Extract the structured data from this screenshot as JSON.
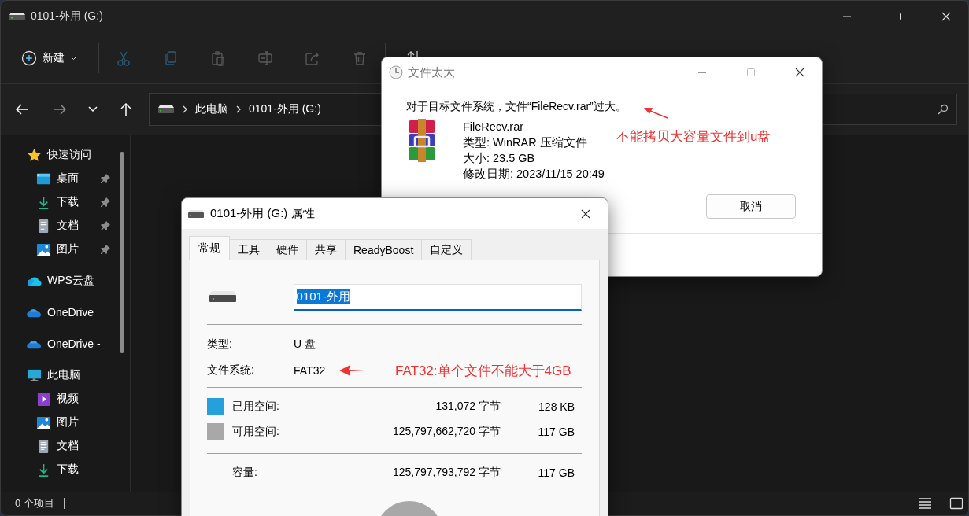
{
  "explorer": {
    "title": "0101-外用 (G:)",
    "new_button": "新建",
    "toolbar": [
      {
        "kind": "cut",
        "disabled": true
      },
      {
        "kind": "copy",
        "disabled": true
      },
      {
        "kind": "paste",
        "disabled": true
      },
      {
        "kind": "rename",
        "disabled": true
      },
      {
        "kind": "share",
        "disabled": true
      },
      {
        "kind": "delete",
        "disabled": true
      }
    ],
    "breadcrumbs": [
      "此电脑",
      "0101-外用 (G:)"
    ],
    "sidebar": [
      {
        "label": "快速访问",
        "kind": "star",
        "children": [
          {
            "label": "桌面",
            "kind": "desktop",
            "pinned": true
          },
          {
            "label": "下载",
            "kind": "download",
            "pinned": true
          },
          {
            "label": "文档",
            "kind": "document",
            "pinned": true
          },
          {
            "label": "图片",
            "kind": "pictures",
            "pinned": true
          }
        ]
      },
      {
        "label": "WPS云盘",
        "kind": "wps"
      },
      {
        "label": "OneDrive",
        "kind": "onedrive"
      },
      {
        "label": "OneDrive -",
        "kind": "onedrive"
      },
      {
        "label": "此电脑",
        "kind": "pc",
        "children": [
          {
            "label": "视频",
            "kind": "video",
            "pinned": false
          },
          {
            "label": "图片",
            "kind": "pictures",
            "pinned": false
          },
          {
            "label": "文档",
            "kind": "document",
            "pinned": false
          },
          {
            "label": "下载",
            "kind": "download",
            "pinned": false
          }
        ]
      }
    ],
    "status": "0 个项目"
  },
  "copy_dialog": {
    "title": "文件太大",
    "message": "对于目标文件系统，文件“FileRecv.rar”过大。",
    "file": {
      "name": "FileRecv.rar",
      "type": "类型: WinRAR 压缩文件",
      "size": "大小: 23.5 GB",
      "modified": "修改日期: 2023/11/15 20:49"
    },
    "annotation": "不能拷贝大容量文件到u盘",
    "cancel_button": "取消"
  },
  "properties_dialog": {
    "title": "0101-外用 (G:) 属性",
    "tabs": [
      {
        "label": "常规",
        "selected": true
      },
      {
        "label": "工具",
        "selected": false
      },
      {
        "label": "硬件",
        "selected": false
      },
      {
        "label": "共享",
        "selected": false
      },
      {
        "label": "ReadyBoost",
        "selected": false
      },
      {
        "label": "自定义",
        "selected": false
      }
    ],
    "name_value": "0101-外用",
    "fields": [
      {
        "label": "类型:",
        "value": "U 盘"
      },
      {
        "label": "文件系统:",
        "value": "FAT32"
      }
    ],
    "annotation": "FAT32:单个文件不能大于4GB",
    "space": [
      {
        "label": "已用空间:",
        "bytes": "131,072 字节",
        "size": "128 KB",
        "color": "#26a0da"
      },
      {
        "label": "可用空间:",
        "bytes": "125,797,662,720 字节",
        "size": "117 GB",
        "color": "#a8a8a8"
      }
    ],
    "capacity": {
      "label": "容量:",
      "bytes": "125,797,793,792 字节",
      "size": "117 GB"
    }
  }
}
